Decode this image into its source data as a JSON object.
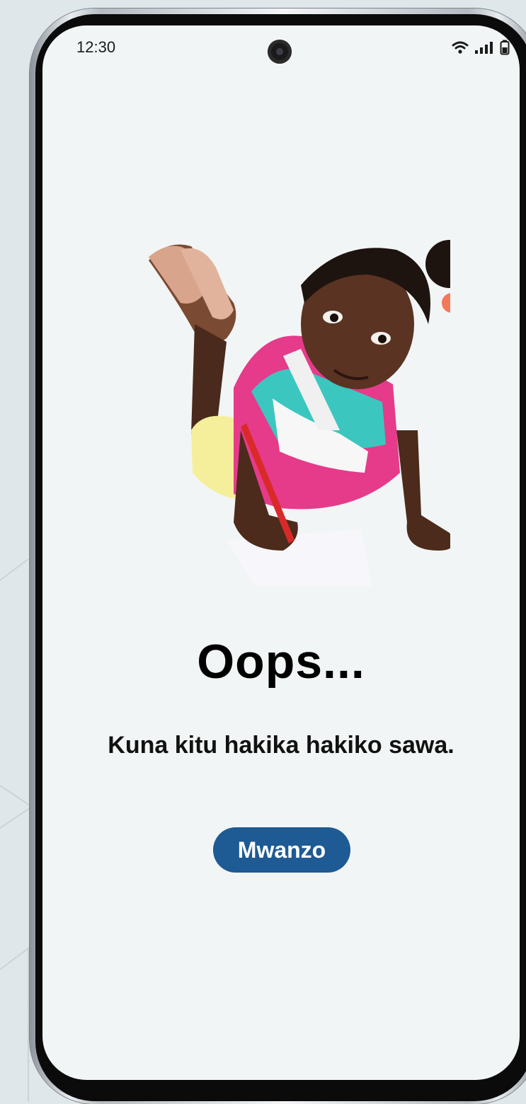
{
  "status_bar": {
    "time": "12:30",
    "icons": [
      "wifi-icon",
      "signal-icon",
      "battery-icon"
    ]
  },
  "illustration": {
    "subject": "girl-drawing-illustration"
  },
  "error": {
    "title": "Oops...",
    "message": "Kuna kitu hakika hakiko sawa."
  },
  "actions": {
    "home_label": "Mwanzo"
  },
  "colors": {
    "background": "#f2f5f5",
    "button": "#1e5a94",
    "text": "#000000"
  }
}
